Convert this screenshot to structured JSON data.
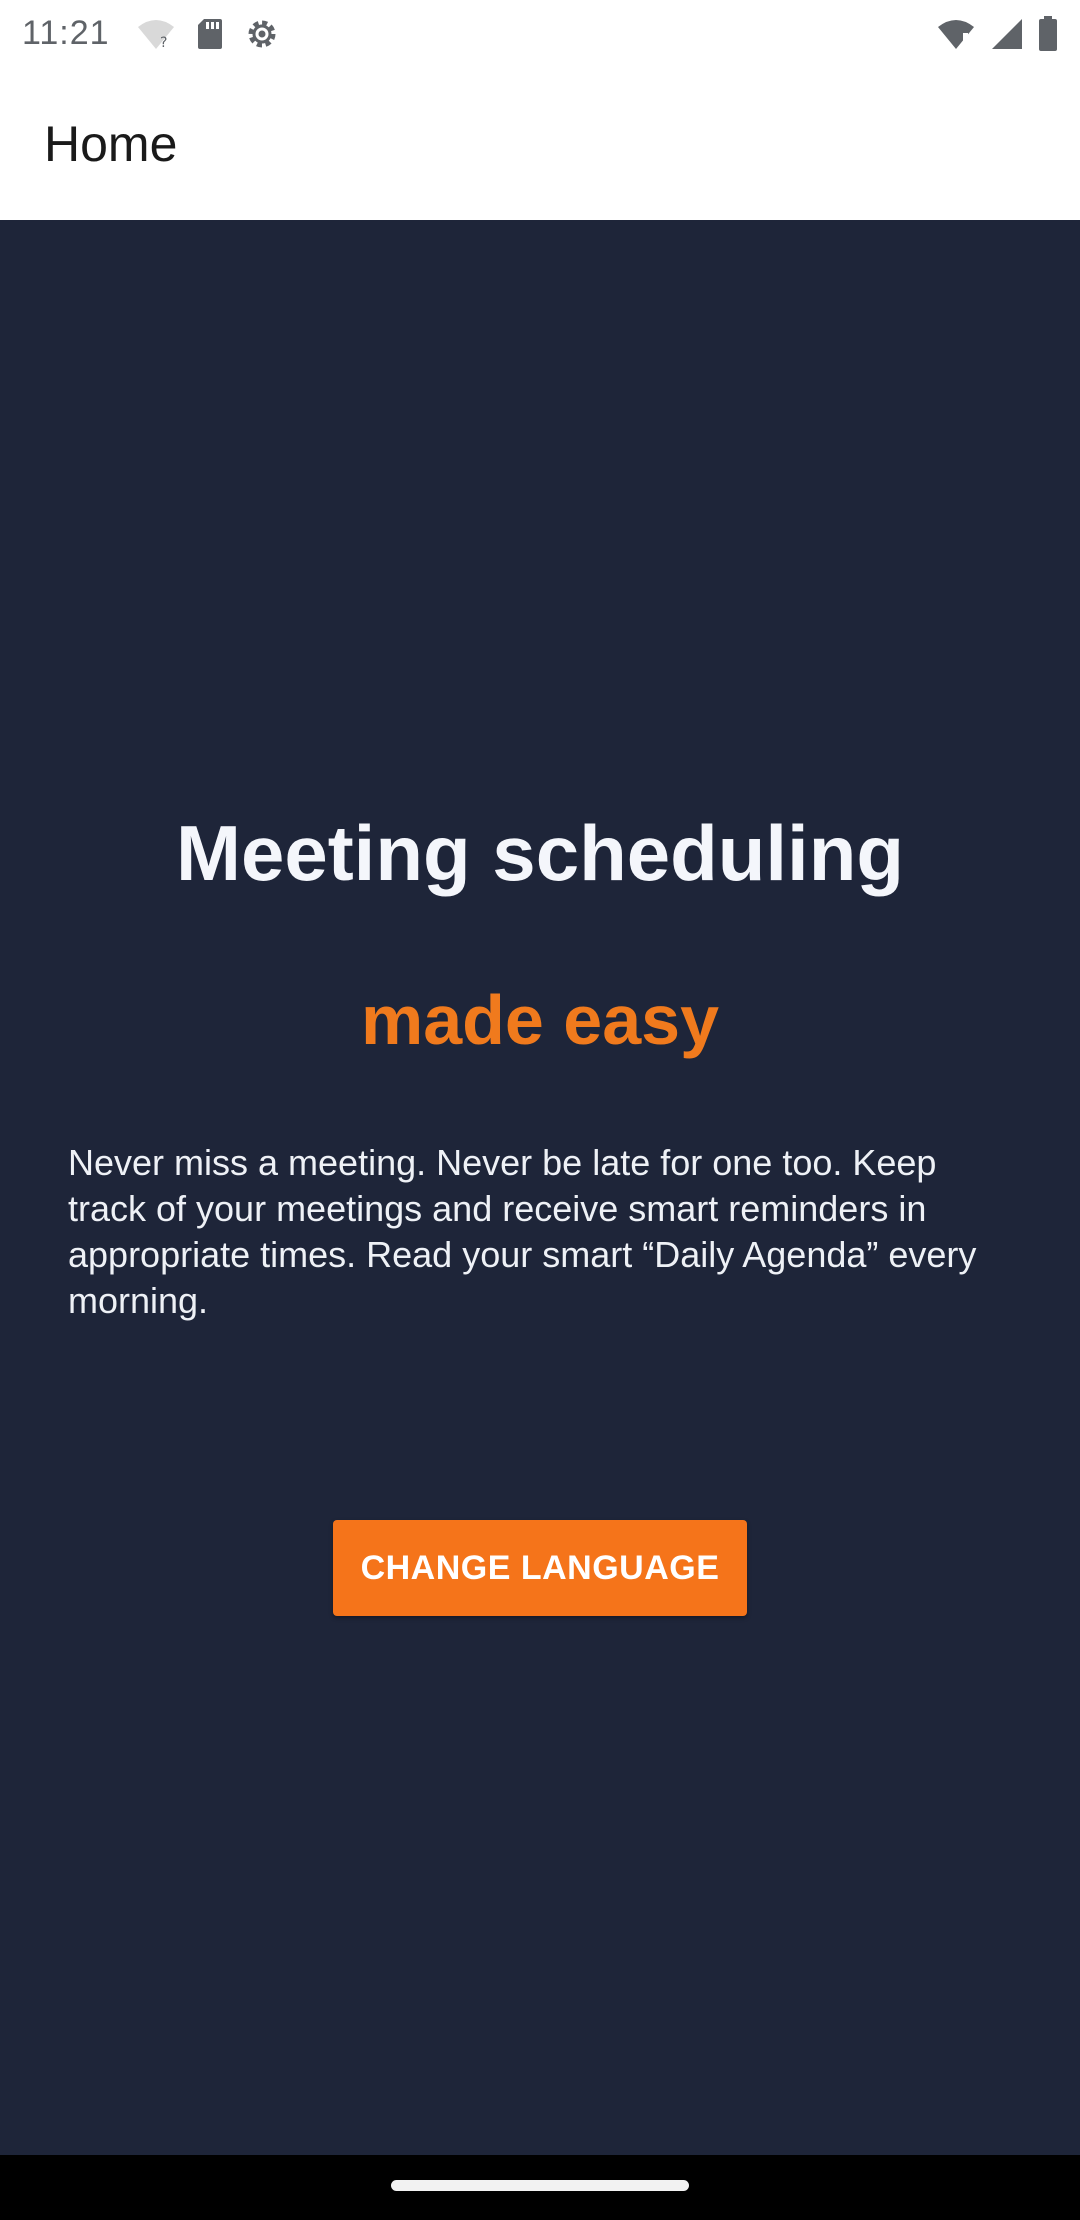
{
  "status_bar": {
    "time": "11:21",
    "left_icons": [
      "wifi-question-icon",
      "sd-card-icon",
      "settings-gear-icon"
    ],
    "right_icons": [
      "wifi-icon",
      "signal-icon",
      "battery-icon"
    ]
  },
  "app_bar": {
    "title": "Home"
  },
  "main": {
    "headline": "Meeting scheduling",
    "subheadline": "made easy",
    "description": "Never miss a meeting. Never be late for one too. Keep track of your meetings and receive smart reminders in appropriate times. Read your smart “Daily Agenda” every morning.",
    "button_label": "CHANGE LANGUAGE"
  },
  "colors": {
    "background": "#1e2539",
    "accent": "#f5741a",
    "app_bar": "#ffffff"
  }
}
